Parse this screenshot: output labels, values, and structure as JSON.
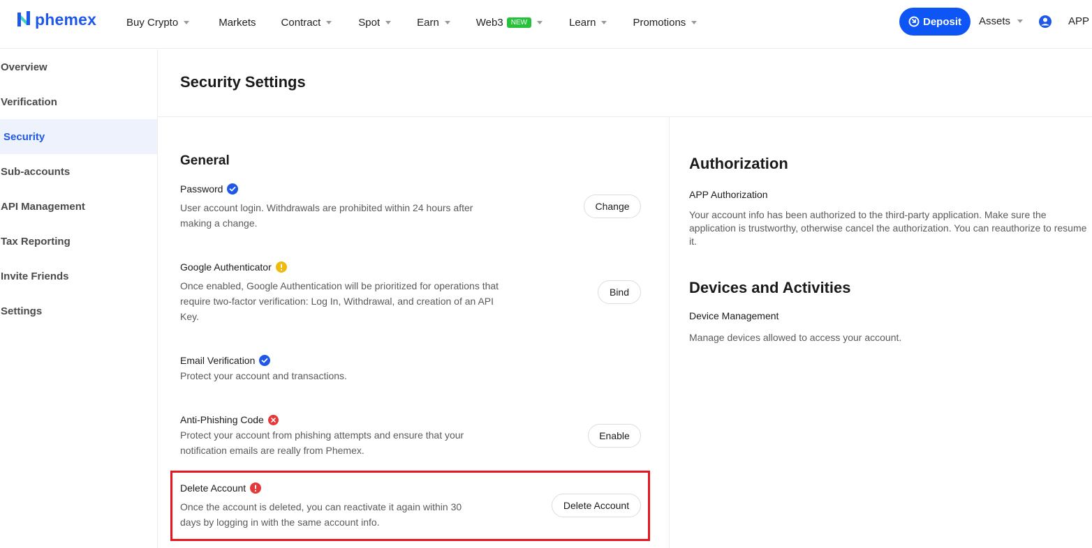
{
  "header": {
    "logo_text": "phemex",
    "nav": [
      {
        "label": "Buy Crypto",
        "dropdown": true
      },
      {
        "label": "Markets",
        "dropdown": false
      },
      {
        "label": "Contract",
        "dropdown": true
      },
      {
        "label": "Spot",
        "dropdown": true
      },
      {
        "label": "Earn",
        "dropdown": true
      },
      {
        "label": "Web3",
        "dropdown": true,
        "badge": "NEW"
      },
      {
        "label": "Learn",
        "dropdown": true
      },
      {
        "label": "Promotions",
        "dropdown": true
      }
    ],
    "deposit_label": "Deposit",
    "assets_label": "Assets",
    "app_label": "APP"
  },
  "sidebar": {
    "items": [
      {
        "label": "Overview"
      },
      {
        "label": "Verification"
      },
      {
        "label": "Security",
        "active": true
      },
      {
        "label": "Sub-accounts"
      },
      {
        "label": "API Management"
      },
      {
        "label": "Tax Reporting"
      },
      {
        "label": "Invite Friends"
      },
      {
        "label": "Settings"
      }
    ]
  },
  "main": {
    "title": "Security Settings",
    "general": {
      "title": "General",
      "rows": [
        {
          "title": "Password",
          "status": "verified",
          "description_lines": [
            "User account login. Withdrawals are prohibited within 24 hours after",
            "making a change."
          ],
          "button": "Change"
        },
        {
          "title": "Google Authenticator",
          "status": "warning",
          "description_lines": [
            "Once enabled, Google Authentication will be prioritized for operations that",
            "require two-factor verification: Log In, Withdrawal, and creation of an API",
            "Key."
          ],
          "button": "Bind"
        },
        {
          "title": "Email Verification",
          "status": "verified",
          "description_lines": [
            "Protect your account and transactions."
          ]
        },
        {
          "title": "Anti-Phishing Code",
          "status": "disabled",
          "description_lines": [
            "Protect your account from phishing attempts and ensure that your",
            "notification emails are really from Phemex."
          ],
          "button": "Enable"
        },
        {
          "title": "Delete Account",
          "status": "danger",
          "description_lines": [
            "Once the account is deleted, you can reactivate it again within 30",
            "days by logging in with the same account info."
          ],
          "button": "Delete Account"
        }
      ]
    },
    "authorization": {
      "title": "Authorization",
      "item_title": "APP Authorization",
      "description_lines": [
        "Your account info has been authorized to the third-party application. Make sure the",
        "application is trustworthy, otherwise cancel the authorization. You can reauthorize to resume",
        "it."
      ]
    },
    "devices": {
      "title": "Devices and Activities",
      "item_title": "Device Management",
      "description": "Manage devices allowed to access your account."
    }
  },
  "colors": {
    "brand": "#1f58e8",
    "deposit": "#0d55f5",
    "verified": "#1f58e8",
    "warning": "#f0b90b",
    "danger": "#e5383b",
    "highlight": "#e8141e",
    "new_badge": "#27c23a"
  },
  "icons": {
    "verified": "check-circle-icon",
    "warning": "exclamation-circle-icon",
    "disabled": "x-circle-icon",
    "danger": "exclamation-circle-icon",
    "deposit": "deposit-icon",
    "user": "user-circle-icon"
  }
}
